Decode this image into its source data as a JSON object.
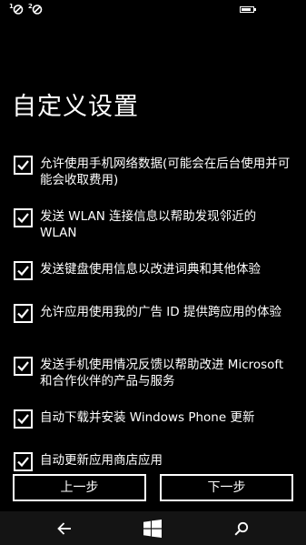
{
  "status_bar": {
    "sim1_label": "1",
    "sim2_label": "2",
    "battery_icon": "battery-icon"
  },
  "title": "自定义设置",
  "options": [
    {
      "label": "允许使用手机网络数据(可能会在后台使用并可能会收取费用)",
      "checked": true
    },
    {
      "label": "发送 WLAN 连接信息以帮助发现邻近的 WLAN",
      "checked": true
    },
    {
      "label": "发送键盘使用信息以改进词典和其他体验",
      "checked": true
    },
    {
      "label": "允许应用使用我的广告 ID 提供跨应用的体验",
      "checked": true
    },
    {
      "label": "发送手机使用情况反馈以帮助改进 Microsoft 和合作伙伴的产品与服务",
      "checked": true
    },
    {
      "label": "自动下载并安装 Windows Phone 更新",
      "checked": true
    },
    {
      "label": "自动更新应用商店应用",
      "checked": true
    }
  ],
  "buttons": {
    "back": "上一步",
    "next": "下一步"
  },
  "navbar": {
    "back_icon": "back-arrow-icon",
    "start_icon": "windows-logo-icon",
    "search_icon": "search-icon"
  },
  "colors": {
    "background": "#000000",
    "foreground": "#ffffff",
    "navbar": "#141414"
  }
}
